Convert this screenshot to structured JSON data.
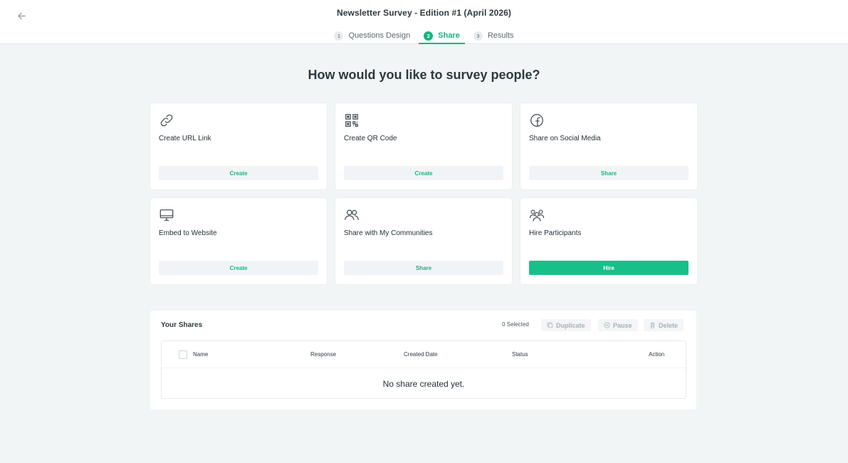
{
  "header": {
    "title": "Newsletter Survey - Edition #1 (April 2026)",
    "steps": [
      {
        "num": "1",
        "label": "Questions Design"
      },
      {
        "num": "2",
        "label": "Share"
      },
      {
        "num": "3",
        "label": "Results"
      }
    ],
    "active_step": "Share",
    "back_icon": "arrow-left-icon"
  },
  "main": {
    "heading": "How would you like to survey people?",
    "cards": [
      {
        "label": "Create URL Link",
        "button": "Create",
        "icon": "link-icon"
      },
      {
        "label": "Create QR Code",
        "button": "Create",
        "icon": "qr-code-icon"
      },
      {
        "label": "Share on Social Media",
        "button": "Share",
        "icon": "facebook-icon"
      },
      {
        "label": "Embed to Website",
        "button": "Create",
        "icon": "monitor-icon"
      },
      {
        "label": "Share with My Communities",
        "button": "Share",
        "icon": "users-icon"
      },
      {
        "label": "Hire Participants",
        "button": "Hire",
        "icon": "group-icon"
      }
    ]
  },
  "shares": {
    "title": "Your Shares",
    "selected": "0 Selected",
    "actions": {
      "duplicate": "Duplicate",
      "pause": "Pause",
      "delete": "Delete"
    },
    "columns": {
      "name": "Name",
      "response": "Response",
      "created": "Created Date",
      "status": "Status",
      "action": "Action"
    },
    "empty": "No share created yet."
  },
  "colors": {
    "accent": "#17b37f",
    "background": "#f1f5f5"
  }
}
